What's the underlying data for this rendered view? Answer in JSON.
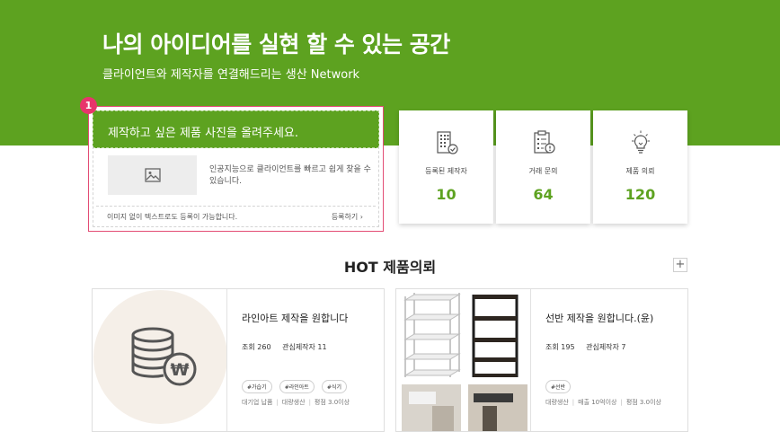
{
  "hero": {
    "title": "나의 아이디어를 실현 할 수 있는 공간",
    "subtitle": "클라이언트와 제작자를 연결해드리는 생산 Network"
  },
  "upload": {
    "badge": "1",
    "heading": "제작하고 싶은 제품 사진을 올려주세요.",
    "description": "인공지능으로 클라이언트를 빠르고 쉽게 찾을 수 있습니다.",
    "note": "이미지 없이 텍스트로도 등록이 가능합니다.",
    "link": "등록하기 ›",
    "image_icon": "image-icon"
  },
  "stats": [
    {
      "label": "등록된 제작자",
      "value": "10",
      "icon": "building-check-icon"
    },
    {
      "label": "거래 문의",
      "value": "64",
      "icon": "clipboard-alert-icon"
    },
    {
      "label": "제품 의뢰",
      "value": "120",
      "icon": "lightbulb-icon"
    }
  ],
  "section": {
    "title": "HOT 제품의뢰",
    "more": "+"
  },
  "products": [
    {
      "title": "라인아트 제작을 원합니다",
      "views": "조회 260",
      "interested": "관심제작자 11",
      "tags": [
        "#가습기",
        "#라인아트",
        "#식기"
      ],
      "info": [
        "대기업 납품",
        "대량생산",
        "평점 3.0이상"
      ],
      "thumb_icon": "coin-stack-won-icon"
    },
    {
      "title": "선반 제작을 원합니다.(윤)",
      "views": "조회 195",
      "interested": "관심제작자 7",
      "tags": [
        "#선반"
      ],
      "info": [
        "대량생산",
        "매출 10억이상",
        "평점 3.0이상"
      ],
      "thumb_icon": "shelf-photo"
    }
  ],
  "colors": {
    "brand_green": "#5da220",
    "badge_pink": "#e8356b",
    "highlight_border": "#e34d75"
  }
}
